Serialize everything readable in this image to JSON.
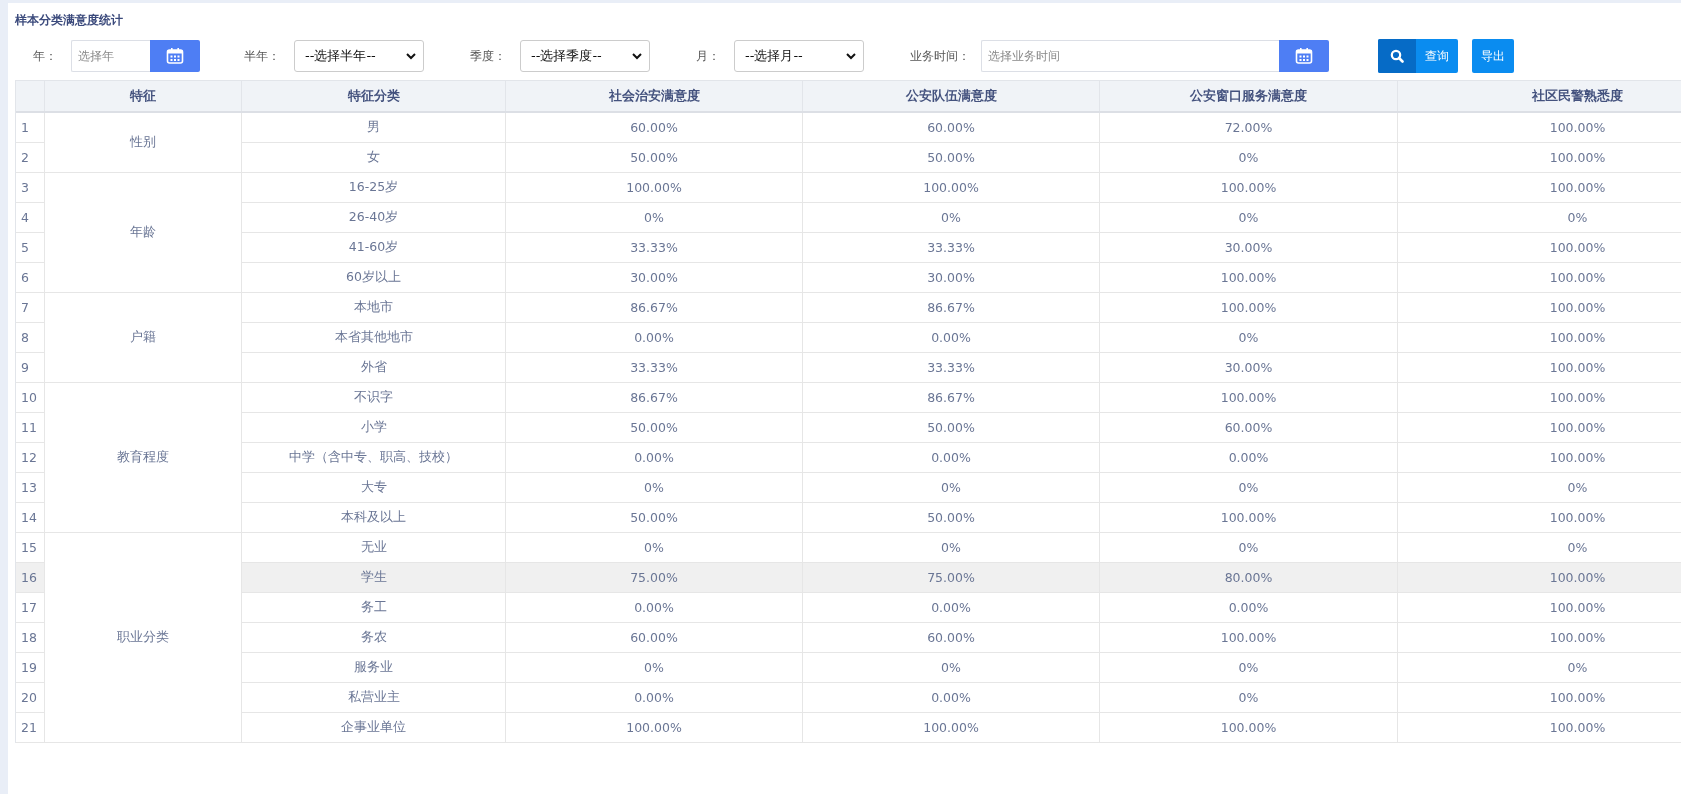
{
  "title": "样本分类满意度统计",
  "filters": [
    {
      "kind": "date",
      "label": "年：",
      "placeholder": "选择年"
    },
    {
      "kind": "select",
      "label": "半年：",
      "value": "--选择半年--"
    },
    {
      "kind": "select",
      "label": "季度：",
      "value": "--选择季度--"
    },
    {
      "kind": "select",
      "label": "月：",
      "value": "--选择月--"
    },
    {
      "kind": "date",
      "label": "业务时间：",
      "placeholder": "选择业务时间"
    }
  ],
  "buttons": [
    {
      "kind": "search",
      "label": "查询"
    },
    {
      "kind": "plain",
      "label": "导出"
    }
  ],
  "table": {
    "columns": [
      "特征",
      "特征分类",
      "社会治安满意度",
      "公安队伍满意度",
      "公安窗口服务满意度",
      "社区民警熟悉度"
    ],
    "groups": [
      {
        "feature": "性别",
        "rows": [
          {
            "index": "1",
            "category": "男",
            "values": [
              "60.00%",
              "60.00%",
              "72.00%",
              "100.00%"
            ],
            "selected": false
          },
          {
            "index": "2",
            "category": "女",
            "values": [
              "50.00%",
              "50.00%",
              "0%",
              "100.00%"
            ],
            "selected": false
          }
        ]
      },
      {
        "feature": "年龄",
        "rows": [
          {
            "index": "3",
            "category": "16-25岁",
            "values": [
              "100.00%",
              "100.00%",
              "100.00%",
              "100.00%"
            ],
            "selected": false
          },
          {
            "index": "4",
            "category": "26-40岁",
            "values": [
              "0%",
              "0%",
              "0%",
              "0%"
            ],
            "selected": false
          },
          {
            "index": "5",
            "category": "41-60岁",
            "values": [
              "33.33%",
              "33.33%",
              "30.00%",
              "100.00%"
            ],
            "selected": false
          },
          {
            "index": "6",
            "category": "60岁以上",
            "values": [
              "30.00%",
              "30.00%",
              "100.00%",
              "100.00%"
            ],
            "selected": false
          }
        ]
      },
      {
        "feature": "户籍",
        "rows": [
          {
            "index": "7",
            "category": "本地市",
            "values": [
              "86.67%",
              "86.67%",
              "100.00%",
              "100.00%"
            ],
            "selected": false
          },
          {
            "index": "8",
            "category": "本省其他地市",
            "values": [
              "0.00%",
              "0.00%",
              "0%",
              "100.00%"
            ],
            "selected": false
          },
          {
            "index": "9",
            "category": "外省",
            "values": [
              "33.33%",
              "33.33%",
              "30.00%",
              "100.00%"
            ],
            "selected": false
          }
        ]
      },
      {
        "feature": "教育程度",
        "rows": [
          {
            "index": "10",
            "category": "不识字",
            "values": [
              "86.67%",
              "86.67%",
              "100.00%",
              "100.00%"
            ],
            "selected": false
          },
          {
            "index": "11",
            "category": "小学",
            "values": [
              "50.00%",
              "50.00%",
              "60.00%",
              "100.00%"
            ],
            "selected": false
          },
          {
            "index": "12",
            "category": "中学（含中专、职高、技校）",
            "values": [
              "0.00%",
              "0.00%",
              "0.00%",
              "100.00%"
            ],
            "selected": false
          },
          {
            "index": "13",
            "category": "大专",
            "values": [
              "0%",
              "0%",
              "0%",
              "0%"
            ],
            "selected": false
          },
          {
            "index": "14",
            "category": "本科及以上",
            "values": [
              "50.00%",
              "50.00%",
              "100.00%",
              "100.00%"
            ],
            "selected": false
          }
        ]
      },
      {
        "feature": "职业分类",
        "rows": [
          {
            "index": "15",
            "category": "无业",
            "values": [
              "0%",
              "0%",
              "0%",
              "0%"
            ],
            "selected": false
          },
          {
            "index": "16",
            "category": "学生",
            "values": [
              "75.00%",
              "75.00%",
              "80.00%",
              "100.00%"
            ],
            "selected": true
          },
          {
            "index": "17",
            "category": "务工",
            "values": [
              "0.00%",
              "0.00%",
              "0.00%",
              "100.00%"
            ],
            "selected": false
          },
          {
            "index": "18",
            "category": "务农",
            "values": [
              "60.00%",
              "60.00%",
              "100.00%",
              "100.00%"
            ],
            "selected": false
          },
          {
            "index": "19",
            "category": "服务业",
            "values": [
              "0%",
              "0%",
              "0%",
              "0%"
            ],
            "selected": false
          },
          {
            "index": "20",
            "category": "私营业主",
            "values": [
              "0.00%",
              "0.00%",
              "0%",
              "100.00%"
            ],
            "selected": false
          },
          {
            "index": "21",
            "category": "企事业单位",
            "values": [
              "100.00%",
              "100.00%",
              "100.00%",
              "100.00%"
            ],
            "selected": false
          }
        ]
      }
    ]
  }
}
